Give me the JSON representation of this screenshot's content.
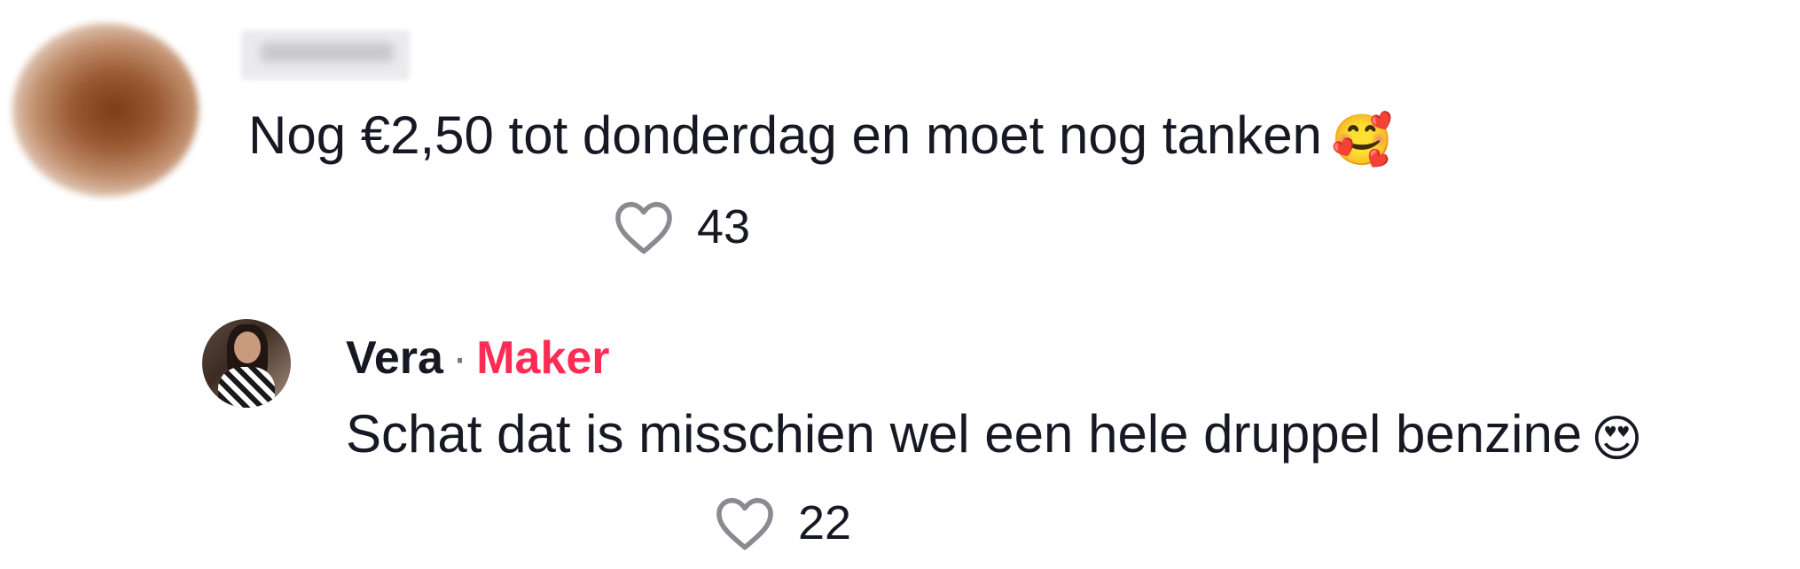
{
  "comment": {
    "text": "Nog €2,50 tot donderdag en moet nog tanken",
    "emoji": "🥰",
    "likes": "43",
    "heart_icon": "heart-outline-icon"
  },
  "reply": {
    "username": "Vera",
    "separator": "·",
    "badge": "Maker",
    "text": "Schat dat is misschien wel een hele druppel benzine",
    "emoji": "😍",
    "likes": "22",
    "heart_icon": "heart-outline-icon"
  },
  "colors": {
    "text": "#161823",
    "maker_badge": "#fe2c55",
    "heart_outline": "#8a8b91"
  }
}
